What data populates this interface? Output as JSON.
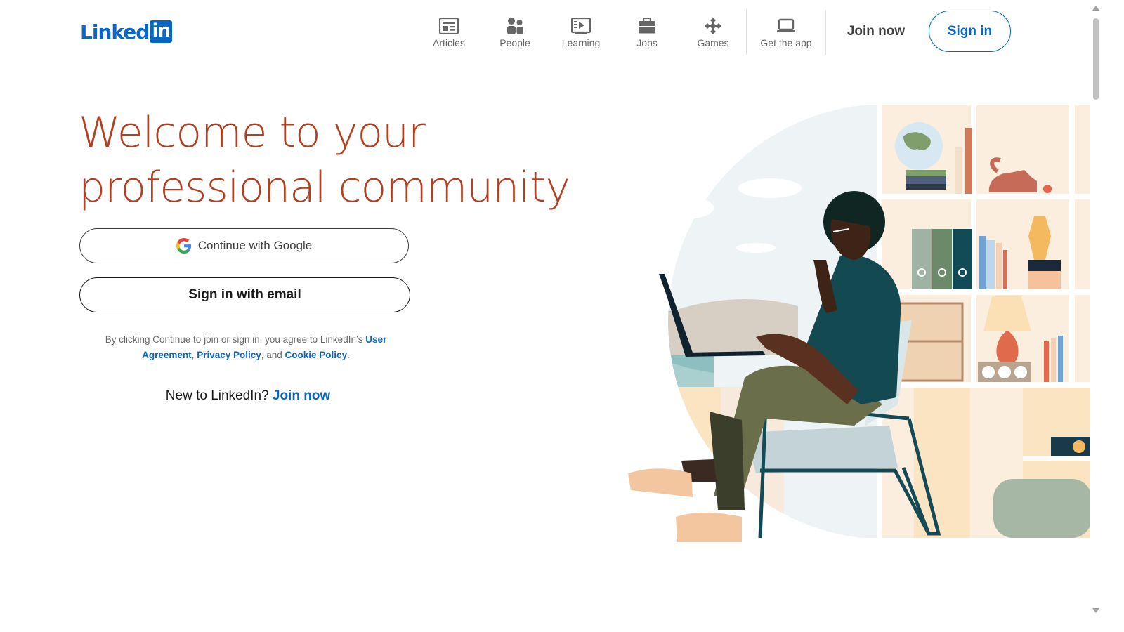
{
  "logo": {
    "text": "Linked",
    "box": "in"
  },
  "nav": {
    "items": [
      {
        "label": "Articles",
        "icon": "articles-icon"
      },
      {
        "label": "People",
        "icon": "people-icon"
      },
      {
        "label": "Learning",
        "icon": "learning-icon"
      },
      {
        "label": "Jobs",
        "icon": "briefcase-icon"
      },
      {
        "label": "Games",
        "icon": "puzzle-icon"
      }
    ],
    "app": {
      "label": "Get the app",
      "icon": "laptop-icon"
    },
    "join_label": "Join now",
    "signin_label": "Sign in"
  },
  "hero": {
    "headline_line1": "Welcome to your",
    "headline_line2": "professional community",
    "google_button": "Continue with Google",
    "email_button": "Sign in with email",
    "legal_prefix": "By clicking Continue to join or sign in, you agree to LinkedIn’s ",
    "legal_user_agreement": "User Agreement",
    "legal_sep1": ", ",
    "legal_privacy": "Privacy Policy",
    "legal_sep2": ", and ",
    "legal_cookie": "Cookie Policy",
    "legal_end": ".",
    "new_prefix": "New to LinkedIn? ",
    "new_link": "Join now"
  },
  "colors": {
    "brand": "#0a66c2",
    "headline": "#b24020"
  }
}
